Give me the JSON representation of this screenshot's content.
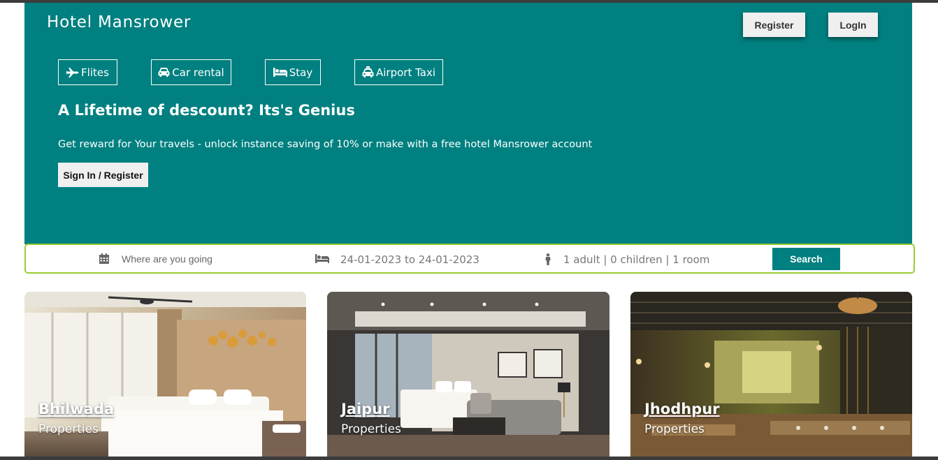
{
  "header": {
    "brand": "Hotel Mansrower",
    "register_label": "Register",
    "login_label": "LogIn"
  },
  "nav": {
    "tabs": [
      {
        "label": "Flites",
        "icon": "plane-icon"
      },
      {
        "label": "Car rental",
        "icon": "car-icon"
      },
      {
        "label": "Stay",
        "icon": "bed-icon"
      },
      {
        "label": "Airport Taxi",
        "icon": "taxi-icon"
      }
    ]
  },
  "hero": {
    "headline": "A Lifetime of descount? Its's Genius",
    "subtext": "Get reward for Your travels - unlock instance saving of 10% or make with a free hotel Mansrower account",
    "signin_label": "Sign In / Register"
  },
  "search": {
    "destination_placeholder": "Where are you going",
    "dates": "24-01-2023 to 24-01-2023",
    "guests": "1 adult | 0 children | 1 room",
    "button_label": "Search"
  },
  "cards": [
    {
      "city": "Bhilwada",
      "subtitle": "Properties"
    },
    {
      "city": "Jaipur",
      "subtitle": "Properties"
    },
    {
      "city": "Jhodhpur",
      "subtitle": "Properties"
    }
  ],
  "colors": {
    "teal": "#008080",
    "search_border": "#9acd32",
    "button_bg": "#efefef"
  }
}
